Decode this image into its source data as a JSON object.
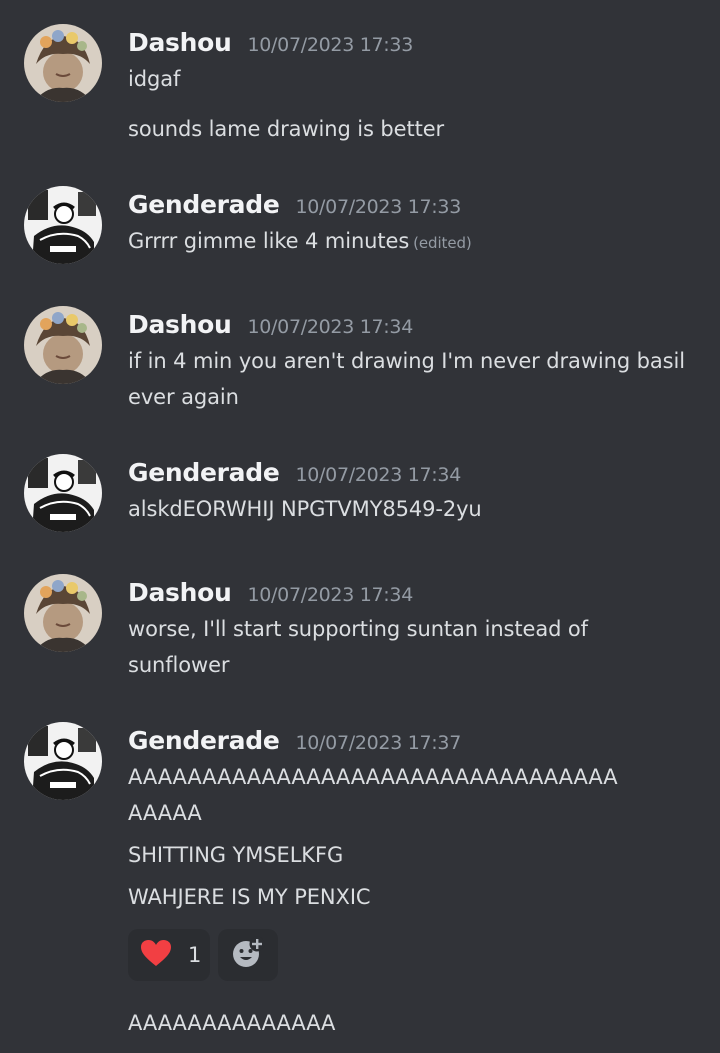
{
  "messages": [
    {
      "username": "Dashou",
      "timestamp": "10/07/2023 17:33",
      "lines": [
        "idgaf",
        "sounds lame drawing is better"
      ]
    },
    {
      "username": "Genderade",
      "timestamp": "10/07/2023 17:33",
      "lines": [
        "Grrrr gimme like 4 minutes"
      ],
      "edited": "(edited)"
    },
    {
      "username": "Dashou",
      "timestamp": "10/07/2023 17:34",
      "lines": [
        "if in 4 min you aren't drawing I'm never drawing basil",
        "ever again"
      ]
    },
    {
      "username": "Genderade",
      "timestamp": "10/07/2023 17:34",
      "lines": [
        "alskdEORWHIJ NPGTVMY8549-2yu"
      ]
    },
    {
      "username": "Dashou",
      "timestamp": "10/07/2023 17:34",
      "lines": [
        "worse, I'll start supporting suntan instead of",
        "sunflower"
      ]
    },
    {
      "username": "Genderade",
      "timestamp": "10/07/2023 17:37",
      "lines": [
        "AAAAAAAAAAAAAAAAAAAAAAAAAAAAAAAAA",
        "AAAAA",
        "SHITTING YMSELKFG",
        "WAHJERE IS MY PENXIC",
        "AAAAAAAAAAAAAA"
      ],
      "reactions": [
        {
          "emoji": "red-heart-icon",
          "count": "1"
        }
      ],
      "add_reaction_icon": "add-reaction-icon"
    }
  ],
  "colors": {
    "background": "#313338",
    "username": "#f2f3f5",
    "timestamp": "#949ba4",
    "text": "#dbdee1",
    "reaction_bg": "#2b2d31",
    "heart": "#f23f43"
  }
}
